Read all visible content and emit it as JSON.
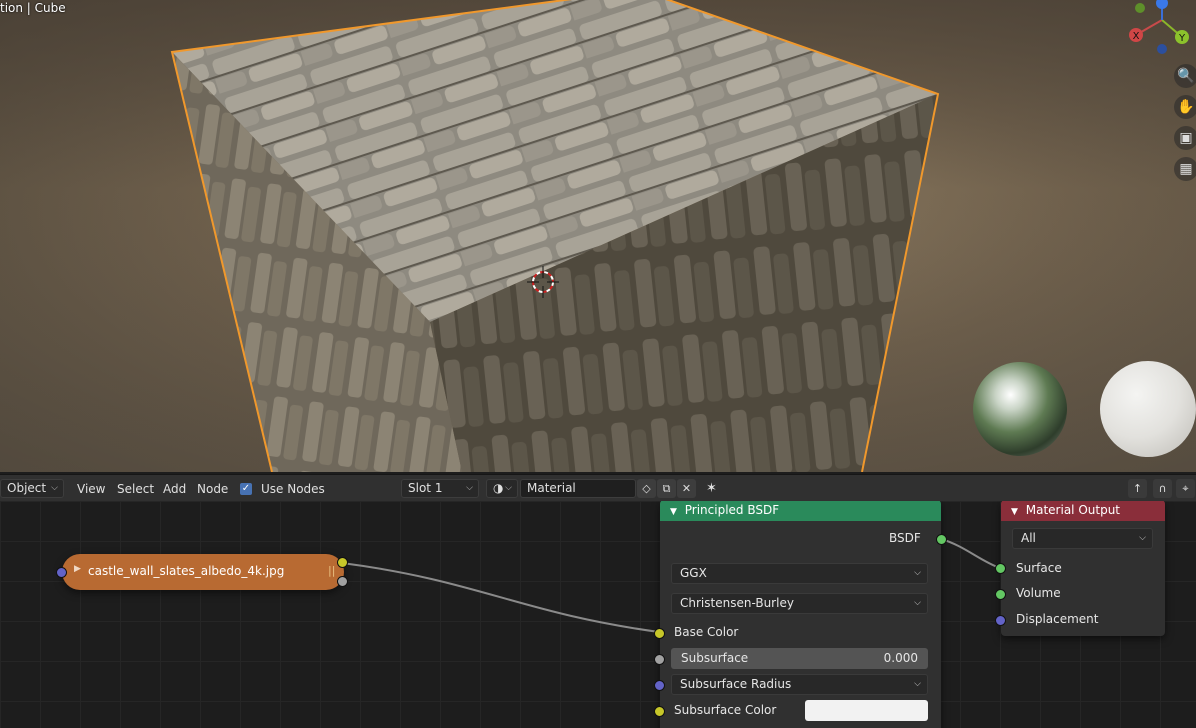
{
  "viewport": {
    "title": "tion | Cube",
    "nav_icons": [
      "zoom-icon",
      "hand-pan-icon",
      "camera-icon",
      "grid-icon"
    ],
    "gizmo": {
      "x_label": "X",
      "y_label": "Y"
    }
  },
  "header": {
    "mode": "Object",
    "menus": [
      "View",
      "Select",
      "Add",
      "Node"
    ],
    "use_nodes_label": "Use Nodes",
    "use_nodes_checked": true,
    "slot": "Slot 1",
    "material_name": "Material"
  },
  "nodes": {
    "image_texture": {
      "label": "castle_wall_slates_albedo_4k.jpg",
      "color": "#b86a32"
    },
    "principled": {
      "title": "Principled BSDF",
      "header_color": "#2a8a5b",
      "output_label": "BSDF",
      "distribution": "GGX",
      "subsurface_method": "Christensen-Burley",
      "base_color_label": "Base Color",
      "subsurface_label": "Subsurface",
      "subsurface_value": "0.000",
      "subsurface_radius_label": "Subsurface Radius",
      "subsurface_color_label": "Subsurface Color"
    },
    "material_output": {
      "title": "Material Output",
      "header_color": "#8a2e3a",
      "target": "All",
      "inputs": [
        "Surface",
        "Volume",
        "Displacement"
      ]
    }
  }
}
